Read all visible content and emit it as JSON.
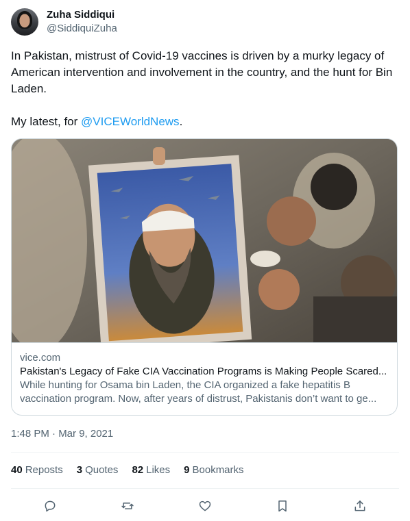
{
  "author": {
    "display_name": "Zuha Siddiqui",
    "handle": "@SiddiquiZuha"
  },
  "tweet": {
    "text_main": "In Pakistan, mistrust of Covid-19 vaccines is driven by a murky legacy of American intervention and involvement in the country, and the hunt for Bin Laden.",
    "text_lead": "My latest, for ",
    "mention": "@VICEWorldNews",
    "text_trail": "."
  },
  "card": {
    "image_icon": "photo-of-crowd-holding-poster",
    "domain": "vice.com",
    "title": "Pakistan's Legacy of Fake CIA Vaccination Programs is Making People Scared...",
    "description_line1": "While hunting for Osama bin Laden, the CIA organized a fake hepatitis B",
    "description_line2": "vaccination program. Now, after years of distrust, Pakistanis don’t want to ge..."
  },
  "timestamp": "1:48 PM · Mar 9, 2021",
  "stats": {
    "reposts_count": "40",
    "reposts_label": "Reposts",
    "quotes_count": "3",
    "quotes_label": "Quotes",
    "likes_count": "82",
    "likes_label": "Likes",
    "bookmarks_count": "9",
    "bookmarks_label": "Bookmarks"
  },
  "actions": [
    "reply-icon",
    "repost-icon",
    "like-icon",
    "bookmark-icon",
    "share-icon"
  ],
  "colors": {
    "link": "#1d9bf0",
    "text": "#0f1419",
    "secondary": "#536471",
    "border": "#cfd9de"
  }
}
